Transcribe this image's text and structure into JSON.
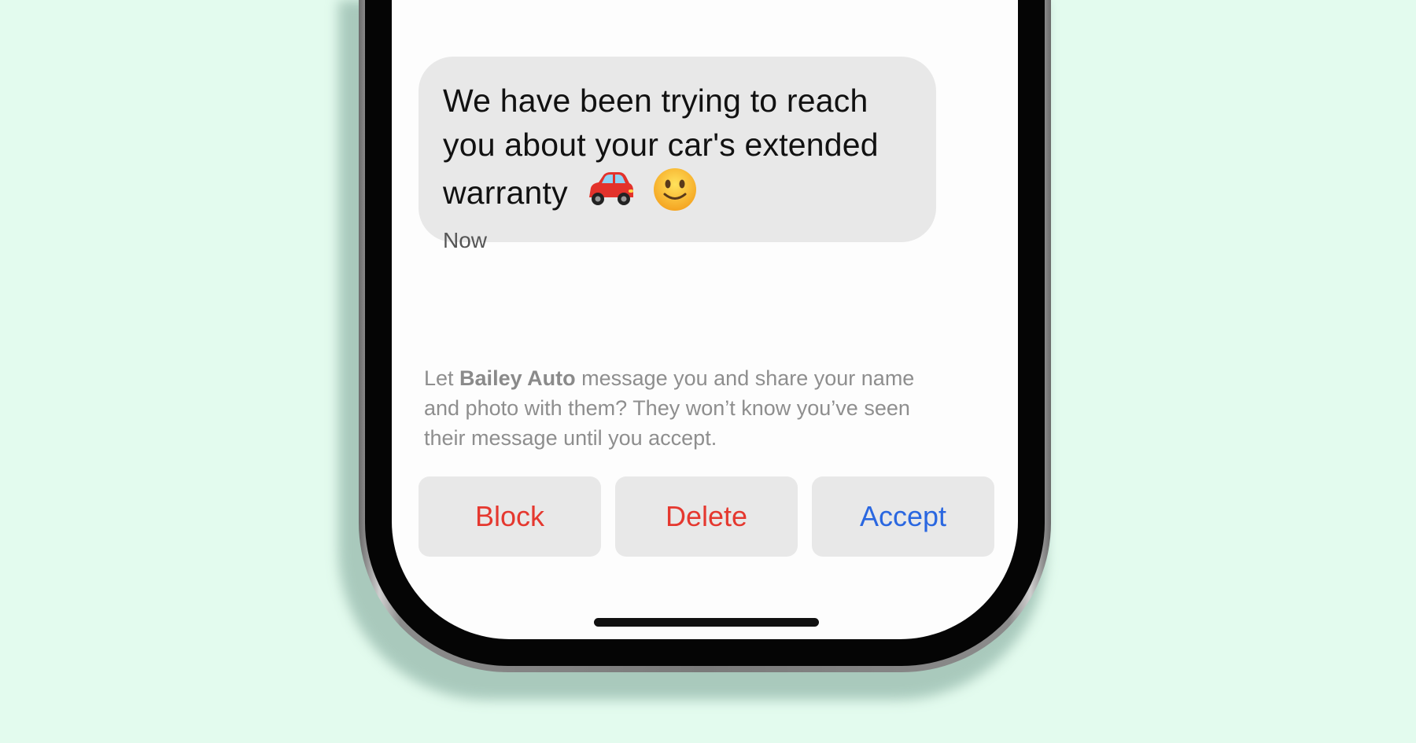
{
  "message": {
    "line1": "We have been trying to reach",
    "line2": "you about your car's extended",
    "line3": "warranty",
    "emoji_car_icon": "car-icon",
    "emoji_smile_icon": "smile-icon",
    "timestamp": "Now"
  },
  "notice": {
    "prefix": "Let ",
    "sender": "Bailey Auto",
    "suffix_line1": " message you and share your name",
    "line2": "and photo with them? They won’t know you’ve seen",
    "line3": "their message until you accept."
  },
  "actions": {
    "block_label": "Block",
    "delete_label": "Delete",
    "accept_label": "Accept",
    "block_color": "#e5382f",
    "delete_color": "#e5382f",
    "accept_color": "#2a67e0"
  },
  "colors": {
    "background": "#e3fbee",
    "bubble": "#e8e8e8",
    "screen": "#fdfdfd"
  }
}
